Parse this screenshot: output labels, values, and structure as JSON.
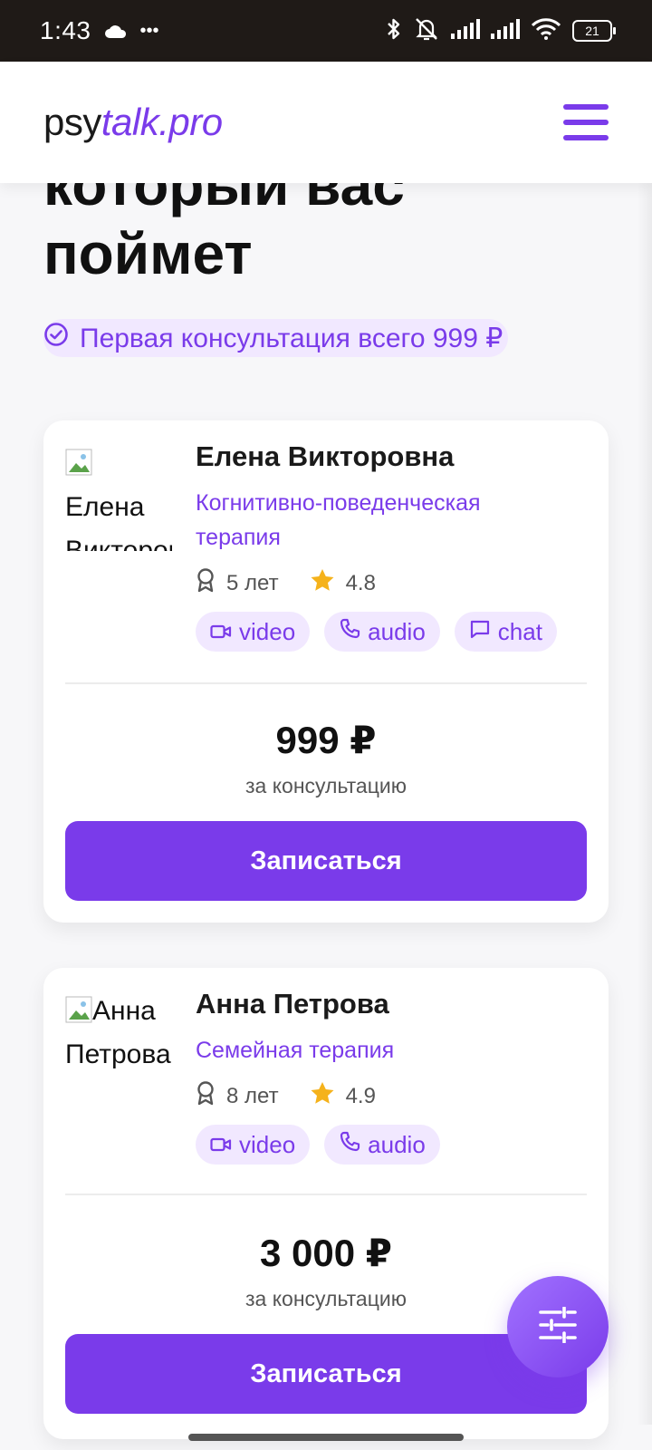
{
  "status_bar": {
    "time": "1:43",
    "dots": "•••",
    "battery": "21"
  },
  "header": {
    "logo_part1": "psy",
    "logo_part2": "talk.pro"
  },
  "hero": {
    "line1": "который вас",
    "line2": "поймет",
    "promo": "Первая консультация всего 999 ₽"
  },
  "therapists": [
    {
      "name": "Елена Викторовна",
      "avatar_alt_line1": "Елена",
      "avatar_alt_line2": "Викторовна",
      "method": "Когнитивно-поведенческая терапия",
      "experience": "5 лет",
      "rating": "4.8",
      "formats": [
        "video",
        "audio",
        "chat"
      ],
      "price": "999 ₽",
      "price_caption": "за консультацию",
      "book_label": "Записаться"
    },
    {
      "name": "Анна Петрова",
      "avatar_alt_line1": "Анна",
      "avatar_alt_line2": "Петрова",
      "method": "Семейная терапия",
      "experience": "8 лет",
      "rating": "4.9",
      "formats": [
        "video",
        "audio"
      ],
      "price": "3 000 ₽",
      "price_caption": "за консультацию",
      "book_label": "Записаться"
    }
  ],
  "colors": {
    "accent": "#7a3bea",
    "chip_bg": "#f1e8ff",
    "star": "#f5b21b"
  },
  "icons": {
    "menu": "hamburger-menu-icon",
    "filter": "sliders-icon",
    "promo": "check-circle-icon",
    "experience": "award-icon",
    "rating": "star-icon",
    "video": "video-camera-icon",
    "audio": "phone-icon",
    "chat": "chat-bubble-icon"
  }
}
